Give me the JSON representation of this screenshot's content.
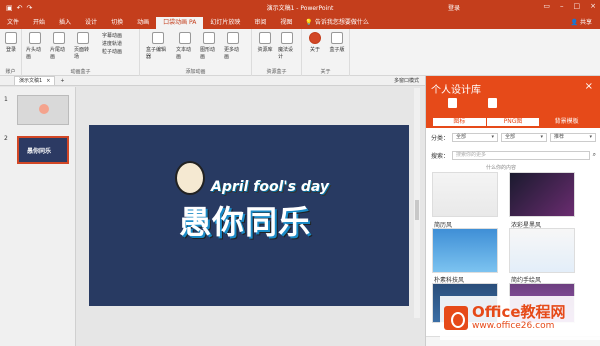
{
  "titlebar": {
    "title": "演示文稿1 - PowerPoint",
    "login": "登录",
    "icons": {
      "undo": "undo-icon",
      "redo": "redo-icon"
    }
  },
  "menu": {
    "items": [
      "文件",
      "开始",
      "插入",
      "设计",
      "切换",
      "动画",
      "口袋动画 PA",
      "幻灯片放映",
      "审阅",
      "视图"
    ],
    "active_index": 6,
    "tell_me": "告诉我您想要做什么",
    "share": "共享"
  },
  "ribbon": {
    "groups": [
      {
        "label": "账户",
        "buttons": [
          "登录"
        ]
      },
      {
        "label": "动画盒子",
        "buttons": [
          "片头动画",
          "片尾动画",
          "页面转场"
        ],
        "small": [
          "字幕动画",
          "进度轨道",
          "粒子动画"
        ]
      },
      {
        "label": "添加动画",
        "buttons": [
          "盒子编辑器",
          "文本动画",
          "图形动画",
          "更多动画"
        ]
      },
      {
        "label": "资源盒子",
        "buttons": [
          "资源库",
          "魔法设计"
        ]
      },
      {
        "label": "关于",
        "buttons": [
          "关于",
          "盒子版"
        ]
      }
    ]
  },
  "doc": {
    "tab": "演示文稿1",
    "close": "×",
    "add": "+",
    "multi_window": "多窗口模式"
  },
  "thumbs": {
    "slide1": "1",
    "slide2": "2",
    "thumb2_text": "愚你同乐"
  },
  "slide": {
    "sub": "April fool's day",
    "main": "愚你同乐"
  },
  "panel": {
    "title": "个人设计库",
    "close": "×",
    "segments": [
      "图标",
      "PNG图",
      "背景模板"
    ],
    "active_segment": 2,
    "filter_label": "分类：",
    "filters": [
      "全部",
      "全部",
      "推荐"
    ],
    "search_label": "搜索：",
    "search_placeholder": "搜索你的更多",
    "hint": "什么你的内容",
    "cards": [
      {
        "label": "简历风"
      },
      {
        "label": "浓彩星黑风"
      },
      {
        "label": "朴素科技风"
      },
      {
        "label": "简约手绘风"
      }
    ]
  },
  "watermark": {
    "main": "Office教程网",
    "url": "www.office26.com"
  }
}
